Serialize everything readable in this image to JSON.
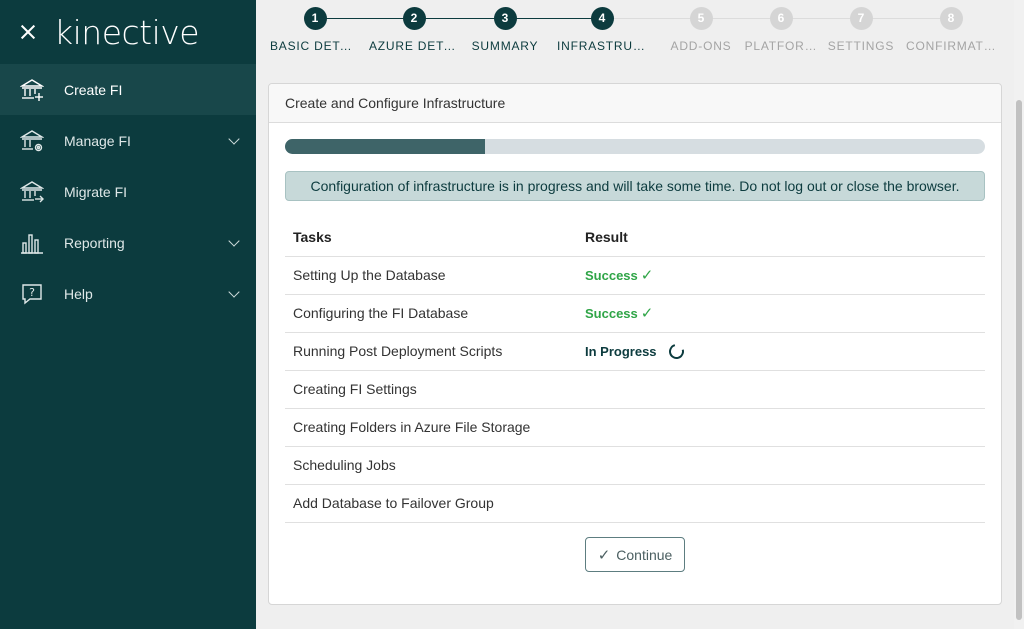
{
  "brand": {
    "logo": "kinective"
  },
  "sidebar": {
    "items": [
      {
        "label": "Create FI",
        "icon": "bank-plus-icon",
        "active": true,
        "expandable": false
      },
      {
        "label": "Manage FI",
        "icon": "bank-gear-icon",
        "active": false,
        "expandable": true
      },
      {
        "label": "Migrate FI",
        "icon": "bank-arrow-icon",
        "active": false,
        "expandable": false
      },
      {
        "label": "Reporting",
        "icon": "bar-chart-icon",
        "active": false,
        "expandable": true
      },
      {
        "label": "Help",
        "icon": "help-bubble-icon",
        "active": false,
        "expandable": true
      }
    ]
  },
  "stepper": {
    "steps": [
      {
        "num": "1",
        "label": "BASIC DETA…",
        "state": "done"
      },
      {
        "num": "2",
        "label": "AZURE DETA…",
        "state": "done"
      },
      {
        "num": "3",
        "label": "SUMMARY",
        "state": "done"
      },
      {
        "num": "4",
        "label": "INFRASTRUCT…",
        "state": "done"
      },
      {
        "num": "5",
        "label": "ADD-ONS",
        "state": "todo"
      },
      {
        "num": "6",
        "label": "PLATFOR…",
        "state": "todo"
      },
      {
        "num": "7",
        "label": "SETTINGS",
        "state": "todo"
      },
      {
        "num": "8",
        "label": "CONFIRMATI…",
        "state": "todo"
      }
    ]
  },
  "card": {
    "title": "Create and Configure Infrastructure",
    "progress_fraction": 0.286,
    "alert": "Configuration of infrastructure is in progress and will take some time. Do not log out or close the browser.",
    "columns": {
      "task": "Tasks",
      "result": "Result"
    },
    "tasks": [
      {
        "task": "Setting Up the Database",
        "result": "Success",
        "status": "success"
      },
      {
        "task": "Configuring the FI Database",
        "result": "Success",
        "status": "success"
      },
      {
        "task": "Running Post Deployment Scripts",
        "result": "In Progress",
        "status": "progress"
      },
      {
        "task": "Creating FI Settings",
        "result": "",
        "status": "pending"
      },
      {
        "task": "Creating Folders in Azure File Storage",
        "result": "",
        "status": "pending"
      },
      {
        "task": "Scheduling Jobs",
        "result": "",
        "status": "pending"
      },
      {
        "task": "Add Database to Failover Group",
        "result": "",
        "status": "pending"
      }
    ],
    "continue_label": "Continue"
  },
  "colors": {
    "sidebar_bg": "#0c3b3e",
    "sidebar_active": "#18474a",
    "success": "#2fa547",
    "step_done": "#0c3b3e",
    "step_todo": "#d5d5d5"
  }
}
